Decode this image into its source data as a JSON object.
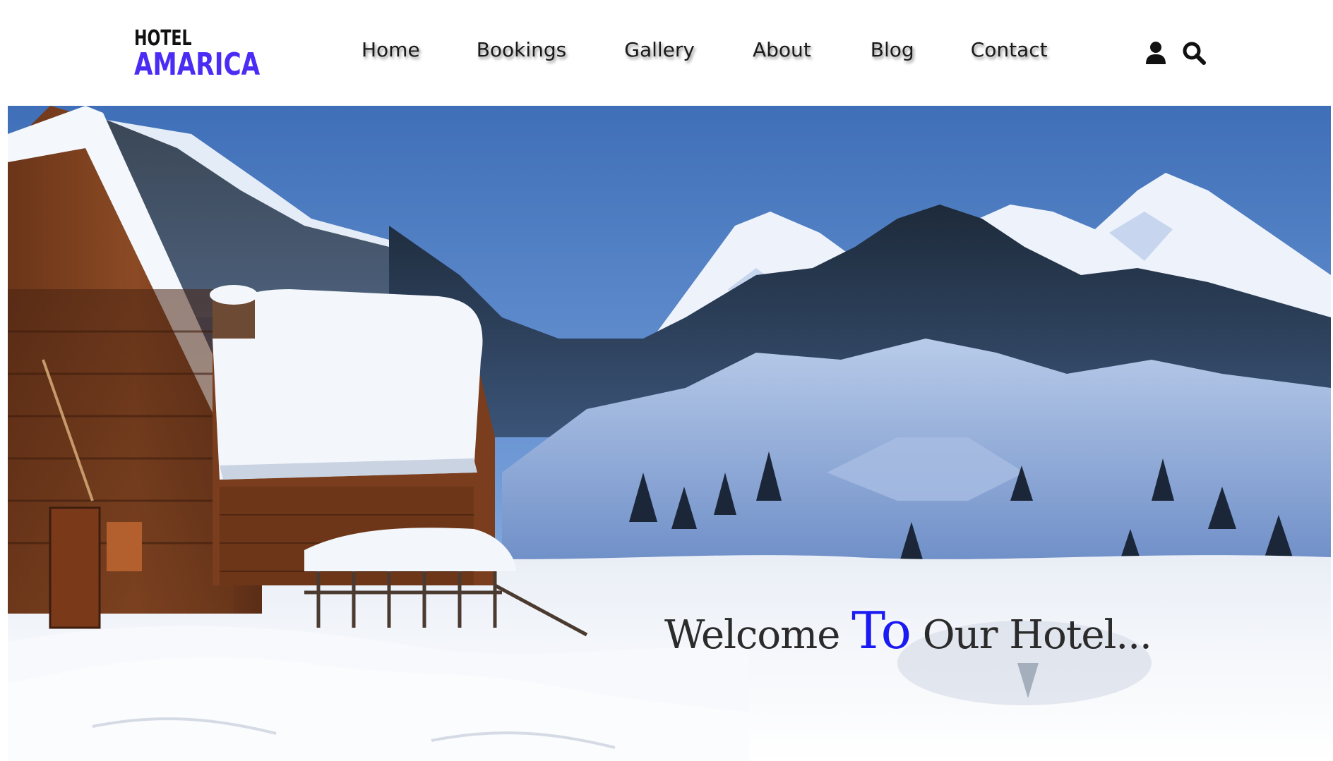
{
  "logo": {
    "line1": "HOTEL",
    "line2": "AMARICA",
    "accent_color": "#4a2cf5"
  },
  "nav": {
    "items": [
      {
        "label": "Home"
      },
      {
        "label": "Bookings"
      },
      {
        "label": "Gallery"
      },
      {
        "label": "About"
      },
      {
        "label": "Blog"
      },
      {
        "label": "Contact"
      }
    ]
  },
  "header_icons": {
    "user": "user-icon",
    "search": "search-icon"
  },
  "hero": {
    "image": "snowy-mountain-chalet-photo",
    "title_pre": "Welcome ",
    "title_accent": "To",
    "title_post": " Our Hotel...",
    "accent_color": "#1a1af2"
  }
}
